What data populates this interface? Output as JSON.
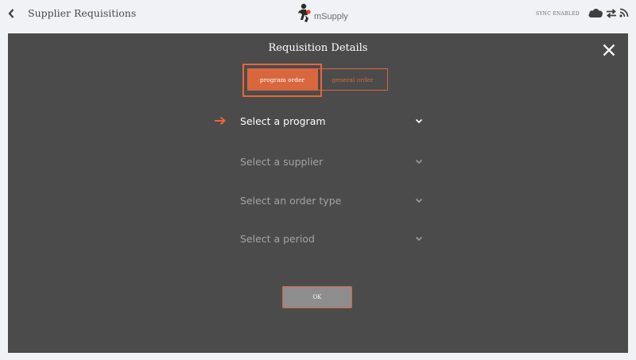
{
  "header": {
    "title": "Supplier Requisitions",
    "back_icon": "chevron-left-icon",
    "logo_text": "mSupply",
    "sync_status": "SYNC ENABLED",
    "icons": [
      "cloud-icon",
      "swap-arrows-icon",
      "rss-icon"
    ]
  },
  "modal": {
    "title": "Requisition Details",
    "close_icon": "close-icon",
    "tabs": [
      {
        "label": "program order",
        "active": true
      },
      {
        "label": "general order",
        "active": false
      }
    ],
    "fields": [
      {
        "label": "Select a program",
        "active": true
      },
      {
        "label": "Select a supplier",
        "active": false
      },
      {
        "label": "Select an order type",
        "active": false
      },
      {
        "label": "Select a period",
        "active": false
      }
    ],
    "ok_label": "OK"
  },
  "colors": {
    "accent": "#d9673d",
    "modal_bg": "#4b4b4b",
    "page_bg": "#f1f2f5"
  }
}
